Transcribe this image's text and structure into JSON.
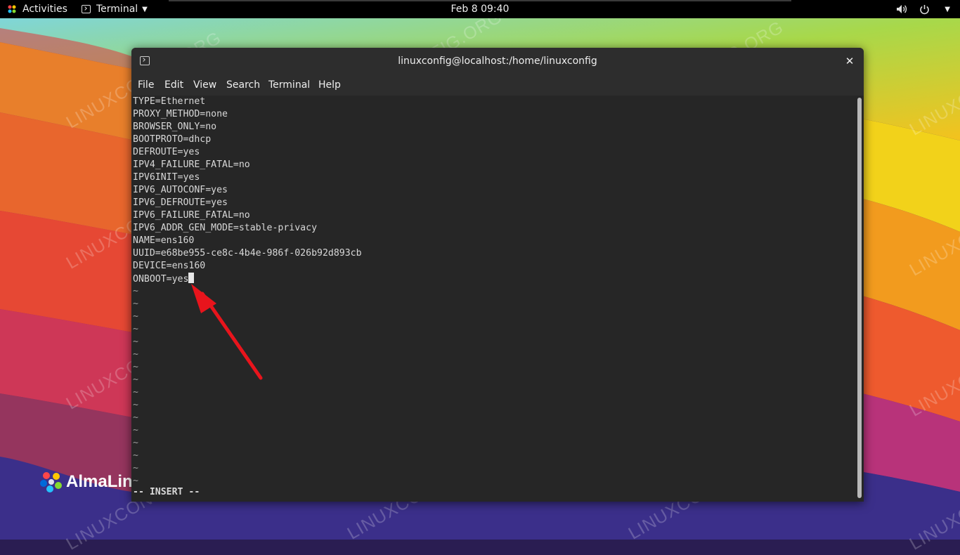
{
  "topbar": {
    "activities": "Activities",
    "app_name": "Terminal",
    "clock": "Feb 8  09:40",
    "icons": [
      "volume-icon",
      "power-icon",
      "caret-down-icon"
    ]
  },
  "window": {
    "title": "linuxconfig@localhost:/home/linuxconfig",
    "close_glyph": "✕",
    "menu": [
      "File",
      "Edit",
      "View",
      "Search",
      "Terminal",
      "Help"
    ]
  },
  "editor": {
    "lines": [
      "TYPE=Ethernet",
      "PROXY_METHOD=none",
      "BROWSER_ONLY=no",
      "BOOTPROTO=dhcp",
      "DEFROUTE=yes",
      "IPV4_FAILURE_FATAL=no",
      "IPV6INIT=yes",
      "IPV6_AUTOCONF=yes",
      "IPV6_DEFROUTE=yes",
      "IPV6_FAILURE_FATAL=no",
      "IPV6_ADDR_GEN_MODE=stable-privacy",
      "NAME=ens160",
      "UUID=e68be955-ce8c-4b4e-986f-026b92d893cb",
      "DEVICE=ens160",
      "ONBOOT=yes"
    ],
    "tilde": "~",
    "tilde_count": 16,
    "mode": "-- INSERT --"
  },
  "desktop": {
    "logo_text": "AlmaLin",
    "watermark": "LINUXCONFIG.ORG"
  },
  "colors": {
    "annotation_arrow": "#e8141c",
    "terminal_bg": "#262626"
  }
}
